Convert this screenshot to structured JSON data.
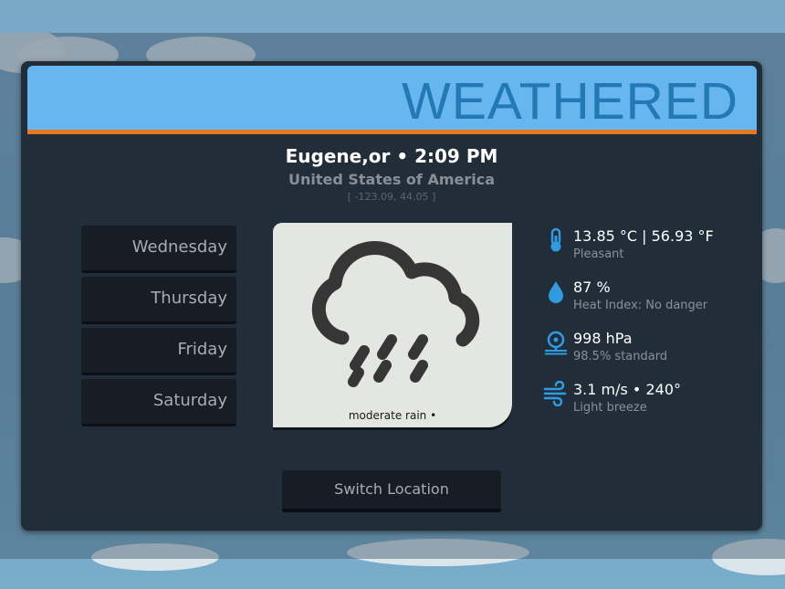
{
  "app": {
    "brand": "WEATHERED"
  },
  "location": {
    "title": "Eugene,or • 2:09 PM",
    "country": "United States of America",
    "coords": "[ -123.09, 44.05 ]"
  },
  "days": [
    "Wednesday",
    "Thursday",
    "Friday",
    "Saturday"
  ],
  "condition": {
    "icon": "rain-cloud-icon",
    "text": "moderate rain •"
  },
  "stats": {
    "temperature": {
      "icon": "thermometer-icon",
      "main": "13.85 °C | 56.93 °F",
      "sub": "Pleasant"
    },
    "humidity": {
      "icon": "water-drop-icon",
      "main": "87 %",
      "sub": "Heat Index: No danger"
    },
    "pressure": {
      "icon": "pressure-gauge-icon",
      "main": "998 hPa",
      "sub": "98.5% standard"
    },
    "wind": {
      "icon": "wind-icon",
      "main": "3.1 m/s • 240°",
      "sub": "Light breeze"
    }
  },
  "actions": {
    "switch_location": "Switch Location"
  },
  "colors": {
    "header": "#67b6ef",
    "brand": "#2379b5",
    "accent_bar": "#e07a24",
    "panel": "#222d3a",
    "icon_blue": "#2f9be0"
  }
}
